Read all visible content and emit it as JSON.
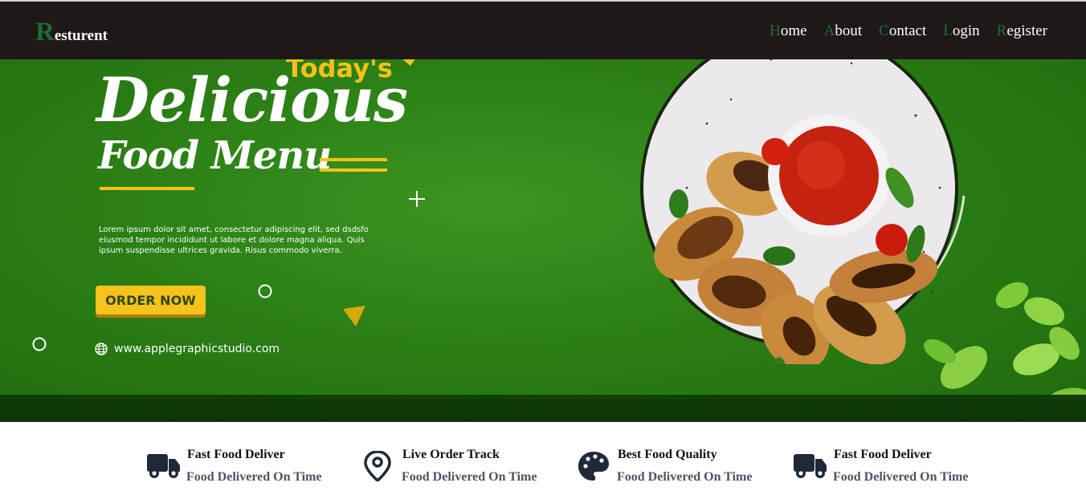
{
  "brand": {
    "initial": "R",
    "rest": "esturent"
  },
  "nav": [
    {
      "initial": "H",
      "rest": "ome"
    },
    {
      "initial": "A",
      "rest": "bout"
    },
    {
      "initial": "C",
      "rest": "ontact"
    },
    {
      "initial": "L",
      "rest": "ogin"
    },
    {
      "initial": "R",
      "rest": "egister"
    }
  ],
  "hero": {
    "tagline": "Today's",
    "title": "Delicious",
    "subtitle": "Food Menu",
    "description": "Lorem ipsum dolor sit amet, consectetur adipiscing elit, sed dsdsfo eiusmod tempor incididunt ut labore et dolore magna aliqua. Quis ipsum suspendisse ultrices gravida. Risus commodo viverra.",
    "button": "ORDER NOW",
    "website": "www.applegraphicstudio.com"
  },
  "features": [
    {
      "title": "Fast Food Deliver",
      "subtitle": "Food Delivered On Time",
      "icon": "truck-icon"
    },
    {
      "title": "Live Order Track",
      "subtitle": "Food Delivered On Time",
      "icon": "map-pin-icon"
    },
    {
      "title": "Best Food Quality",
      "subtitle": "Food Delivered On Time",
      "icon": "palette-icon"
    },
    {
      "title": "Fast Food Deliver",
      "subtitle": "Food Delivered On Time",
      "icon": "truck-icon"
    }
  ],
  "colors": {
    "navbar_bg": "#1e1918",
    "accent_green": "#1e6e34",
    "hero_green": "#2b7f15",
    "hero_yellow": "#f5c117",
    "feature_subtitle": "#4b5563"
  }
}
